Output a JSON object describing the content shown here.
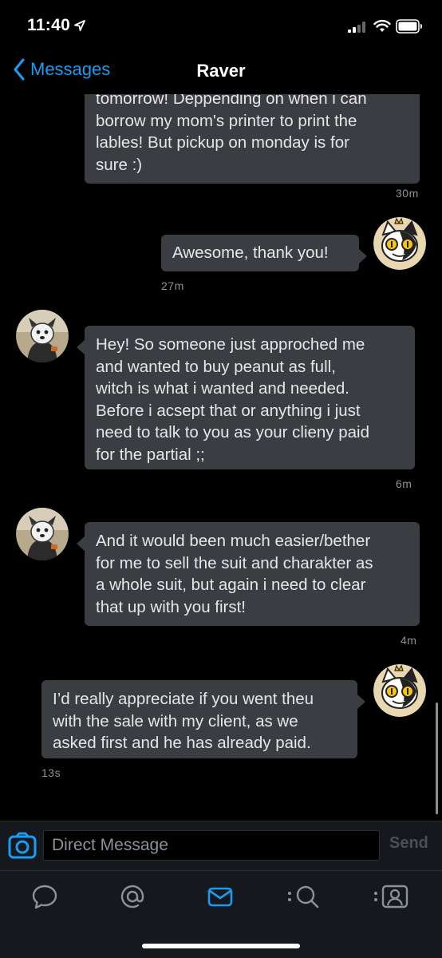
{
  "status_bar": {
    "time": "11:40"
  },
  "nav": {
    "back_label": "Messages",
    "title": "Raver"
  },
  "messages": [
    {
      "direction": "in",
      "text_lines": [
        "tomorrow! Deppending on when i can",
        "borrow my mom's printer to print the",
        "lables! But pickup on monday is for",
        "sure :)"
      ],
      "time": "30m"
    },
    {
      "direction": "out",
      "text_lines": [
        "Awesome, thank you!"
      ],
      "time": "27m"
    },
    {
      "direction": "in",
      "text_lines": [
        "Hey! So someone just approched me",
        "and wanted to buy peanut as full,",
        "witch is what i wanted and needed.",
        "Before i acsept that or anything i just",
        "need to talk to you as your clieny paid",
        "for the partial ;;"
      ],
      "time": "6m"
    },
    {
      "direction": "in",
      "text_lines": [
        "And it would been much easier/bether",
        "for me to sell the suit and charakter as",
        "a whole suit, but again i need to clear",
        "that up with you first!"
      ],
      "time": "4m"
    },
    {
      "direction": "out",
      "text_lines": [
        "I’d really appreciate if you went theu",
        "with the sale with my client, as we",
        "asked first and he has already paid."
      ],
      "time": "13s"
    }
  ],
  "composer": {
    "placeholder": "Direct Message",
    "send_label": "Send"
  },
  "tabs": [
    {
      "icon": "home-chat-icon"
    },
    {
      "icon": "mentions-icon"
    },
    {
      "icon": "messages-icon",
      "active": true
    },
    {
      "icon": "search-icon"
    },
    {
      "icon": "profile-icon"
    }
  ],
  "colors": {
    "accent": "#1d9bf0",
    "bubble": "#3a3d42",
    "background": "#000000",
    "bar": "#15181c"
  }
}
